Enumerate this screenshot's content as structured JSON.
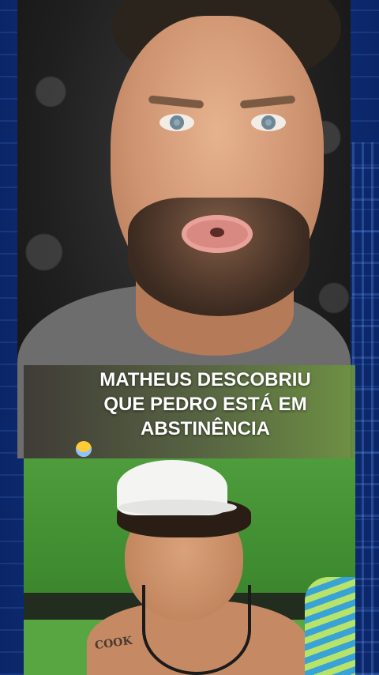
{
  "caption": {
    "line1": "MATHEUS DESCOBRIU",
    "line2": "QUE PEDRO ESTÁ EM",
    "line3": "ABSTINÊNCIA",
    "emoji": "fearful-face-emoji"
  },
  "bottom_video": {
    "tattoo_text": "COOK"
  },
  "colors": {
    "frame_blue": "#0d2a73",
    "caption_text": "#ffffff",
    "caption_bg_left": "#3c3732",
    "caption_bg_right": "#6e963c"
  }
}
